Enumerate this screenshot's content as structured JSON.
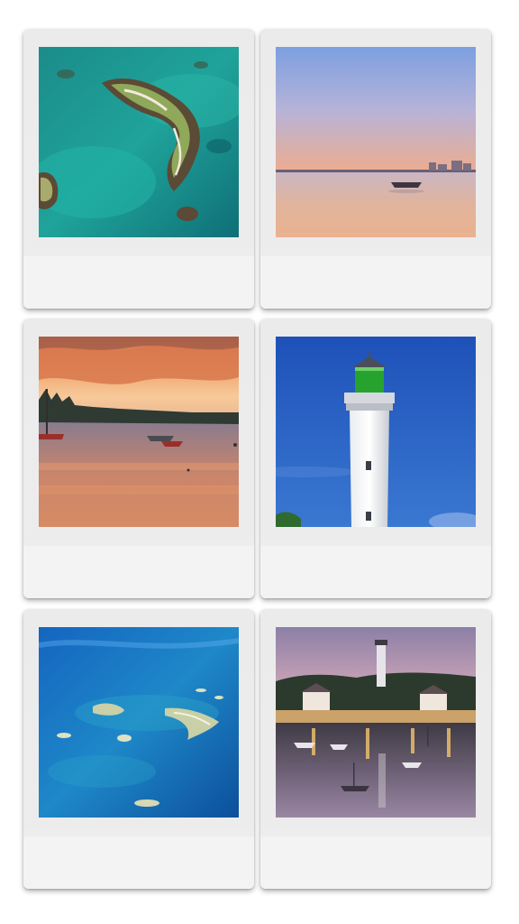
{
  "gallery": {
    "photos": [
      {
        "subject": "aerial-islands-turquoise-sea"
      },
      {
        "subject": "sunset-calm-bay-boat"
      },
      {
        "subject": "sunset-harbor-boats-orange-clouds"
      },
      {
        "subject": "lighthouse-green-lantern-blue-sky"
      },
      {
        "subject": "aerial-islands-blue-sea"
      },
      {
        "subject": "harbor-dusk-lighthouse-reflections"
      }
    ]
  }
}
